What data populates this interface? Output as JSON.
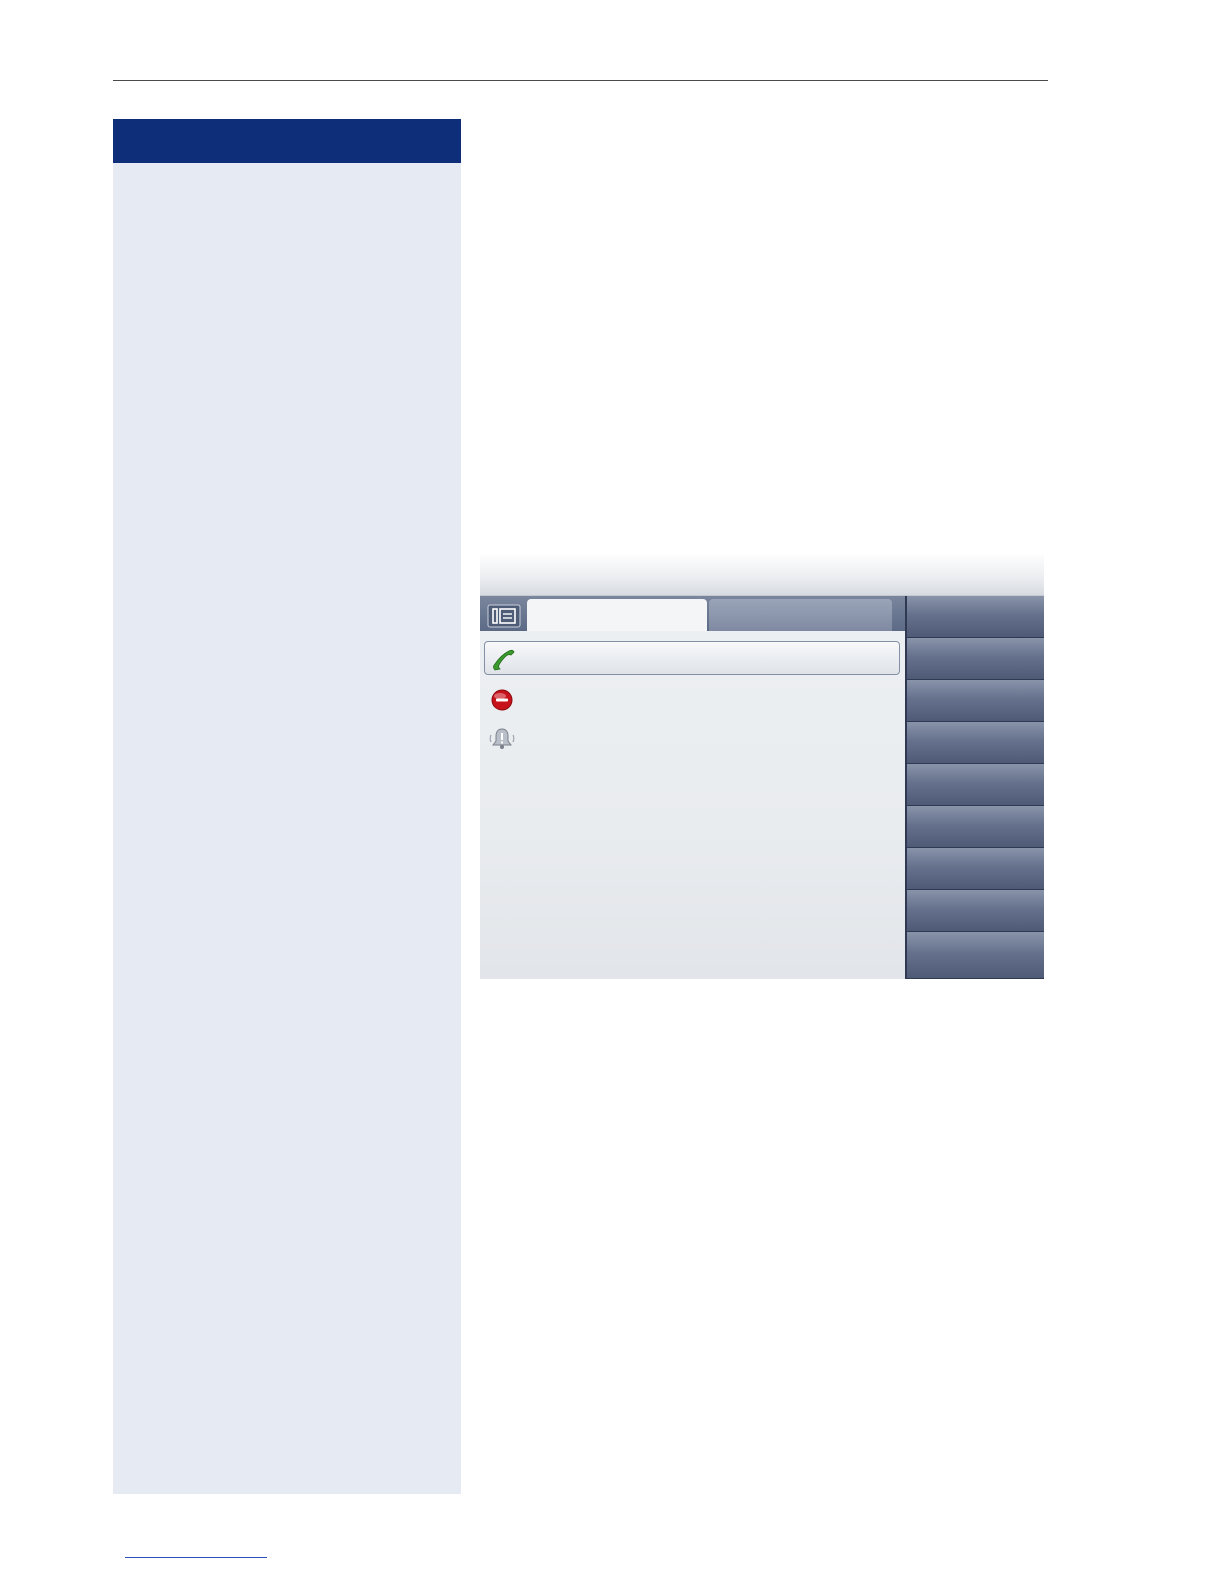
{
  "document": {
    "header_rule": true,
    "sidebar_heading": ""
  },
  "phone_screen": {
    "title": "",
    "tabs": [
      {
        "label": "",
        "state": "active"
      },
      {
        "label": "",
        "state": "inactive"
      }
    ],
    "list": [
      {
        "icon": "phone-handset-icon",
        "text": "",
        "selected": true
      },
      {
        "icon": "do-not-disturb-icon",
        "text": "",
        "selected": false
      },
      {
        "icon": "alert-bell-icon",
        "text": "",
        "selected": false
      }
    ],
    "softkeys": [
      "",
      "",
      "",
      "",
      "",
      "",
      "",
      "",
      ""
    ],
    "colors": {
      "sidebar_header": "#0e2e7a",
      "sidebar_bg": "#e6eaf2",
      "softkey_column": "#3e4b66",
      "phone_icon": "#3a9a2e",
      "dnd_icon": "#c8121b"
    }
  }
}
